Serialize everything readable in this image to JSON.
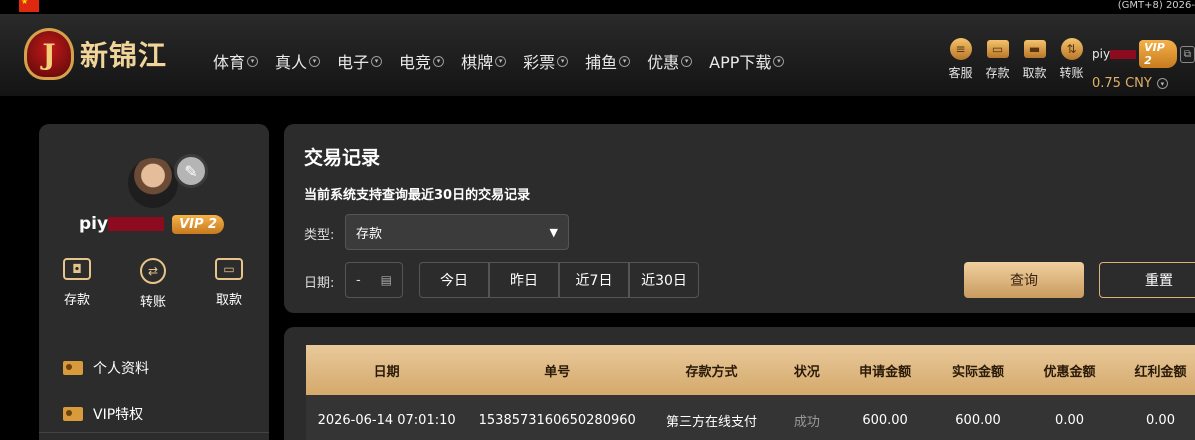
{
  "topbar": {
    "timezone": "(GMT+8) 2026-"
  },
  "brand": {
    "logo_letter": "J",
    "name": "新锦江"
  },
  "nav": {
    "items": [
      {
        "label": "体育"
      },
      {
        "label": "真人"
      },
      {
        "label": "电子"
      },
      {
        "label": "电竞"
      },
      {
        "label": "棋牌"
      },
      {
        "label": "彩票"
      },
      {
        "label": "捕鱼"
      },
      {
        "label": "优惠"
      },
      {
        "label": "APP下载"
      }
    ]
  },
  "quick_actions": [
    {
      "label": "客服",
      "icon": "chat-icon"
    },
    {
      "label": "存款",
      "icon": "wallet-icon"
    },
    {
      "label": "取款",
      "icon": "card-icon"
    },
    {
      "label": "转账",
      "icon": "transfer-icon"
    }
  ],
  "user": {
    "name_visible": "piy",
    "vip_label": "VIP 2",
    "balance": "0.75 CNY"
  },
  "sidebar": {
    "name_visible": "piy",
    "vip_label": "VIP 2",
    "actions": [
      {
        "label": "存款",
        "icon": "wallet-icon"
      },
      {
        "label": "转账",
        "icon": "transfer-icon"
      },
      {
        "label": "取款",
        "icon": "card-icon"
      }
    ],
    "menu": [
      {
        "label": "个人资料",
        "icon": "profile-card-icon"
      },
      {
        "label": "VIP特权",
        "icon": "vip-card-icon"
      }
    ]
  },
  "filter": {
    "title": "交易记录",
    "subtitle": "当前系统支持查询最近30日的交易记录",
    "type_label": "类型:",
    "type_value": "存款",
    "date_label": "日期:",
    "date_value": "-",
    "ranges": [
      "今日",
      "昨日",
      "近7日",
      "近30日"
    ],
    "query_label": "查询",
    "reset_label": "重置"
  },
  "table": {
    "headers": [
      "日期",
      "单号",
      "存款方式",
      "状况",
      "申请金额",
      "实际金额",
      "优惠金额",
      "红利金额"
    ],
    "rows": [
      [
        "2026-06-14 07:01:10",
        "1538573160650280960",
        "第三方在线支付",
        "成功",
        "600.00",
        "600.00",
        "0.00",
        "0.00"
      ]
    ]
  },
  "colors": {
    "accent_gold": "#d4a96c",
    "vip_orange": "#f4b24a",
    "redaction": "#8c0b1e"
  }
}
